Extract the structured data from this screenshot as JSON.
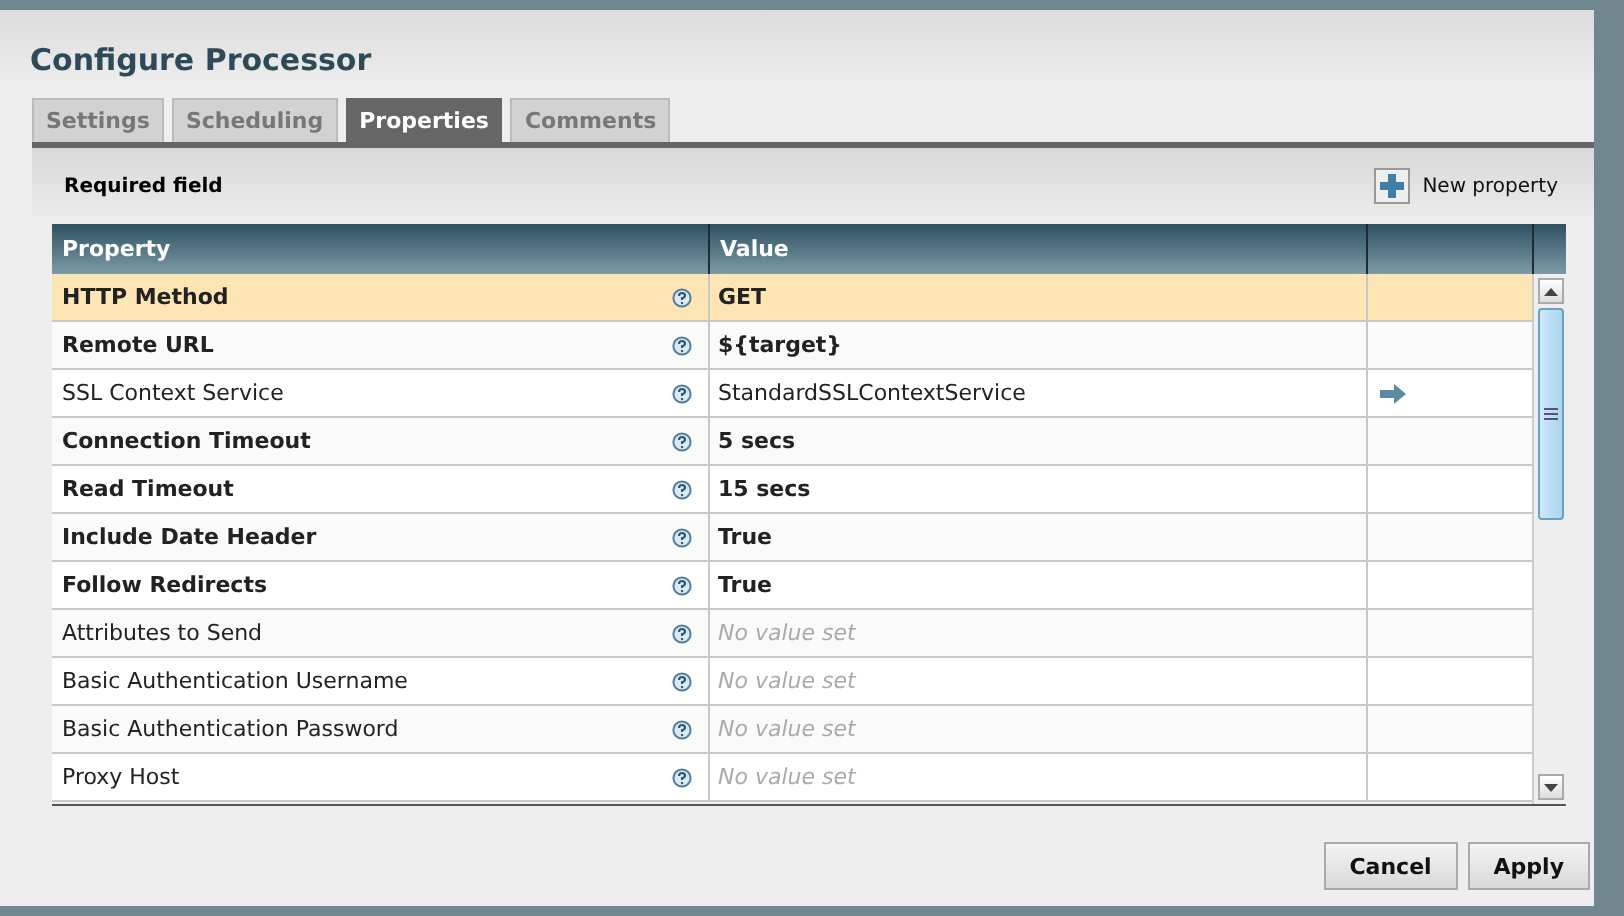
{
  "dialog": {
    "title": "Configure Processor"
  },
  "tabs": [
    {
      "label": "Settings",
      "selected": false
    },
    {
      "label": "Scheduling",
      "selected": false
    },
    {
      "label": "Properties",
      "selected": true
    },
    {
      "label": "Comments",
      "selected": false
    }
  ],
  "legend": "Required field",
  "new_property_button": "New property",
  "table": {
    "columns": [
      "Property",
      "Value"
    ],
    "rows": [
      {
        "name": "HTTP Method",
        "required": true,
        "selected": true,
        "value": "GET",
        "link": false
      },
      {
        "name": "Remote URL",
        "required": true,
        "selected": false,
        "value": "${target}",
        "link": false
      },
      {
        "name": "SSL Context Service",
        "required": false,
        "selected": false,
        "value": "StandardSSLContextService",
        "link": true
      },
      {
        "name": "Connection Timeout",
        "required": true,
        "selected": false,
        "value": "5 secs",
        "link": false
      },
      {
        "name": "Read Timeout",
        "required": true,
        "selected": false,
        "value": "15 secs",
        "link": false
      },
      {
        "name": "Include Date Header",
        "required": true,
        "selected": false,
        "value": "True",
        "link": false
      },
      {
        "name": "Follow Redirects",
        "required": true,
        "selected": false,
        "value": "True",
        "link": false
      },
      {
        "name": "Attributes to Send",
        "required": false,
        "selected": false,
        "placeholder": "No value set",
        "link": false
      },
      {
        "name": "Basic Authentication Username",
        "required": false,
        "selected": false,
        "placeholder": "No value set",
        "link": false
      },
      {
        "name": "Basic Authentication Password",
        "required": false,
        "selected": false,
        "placeholder": "No value set",
        "link": false
      },
      {
        "name": "Proxy Host",
        "required": false,
        "selected": false,
        "placeholder": "No value set",
        "link": false
      }
    ]
  },
  "buttons": [
    "Cancel",
    "Apply"
  ]
}
